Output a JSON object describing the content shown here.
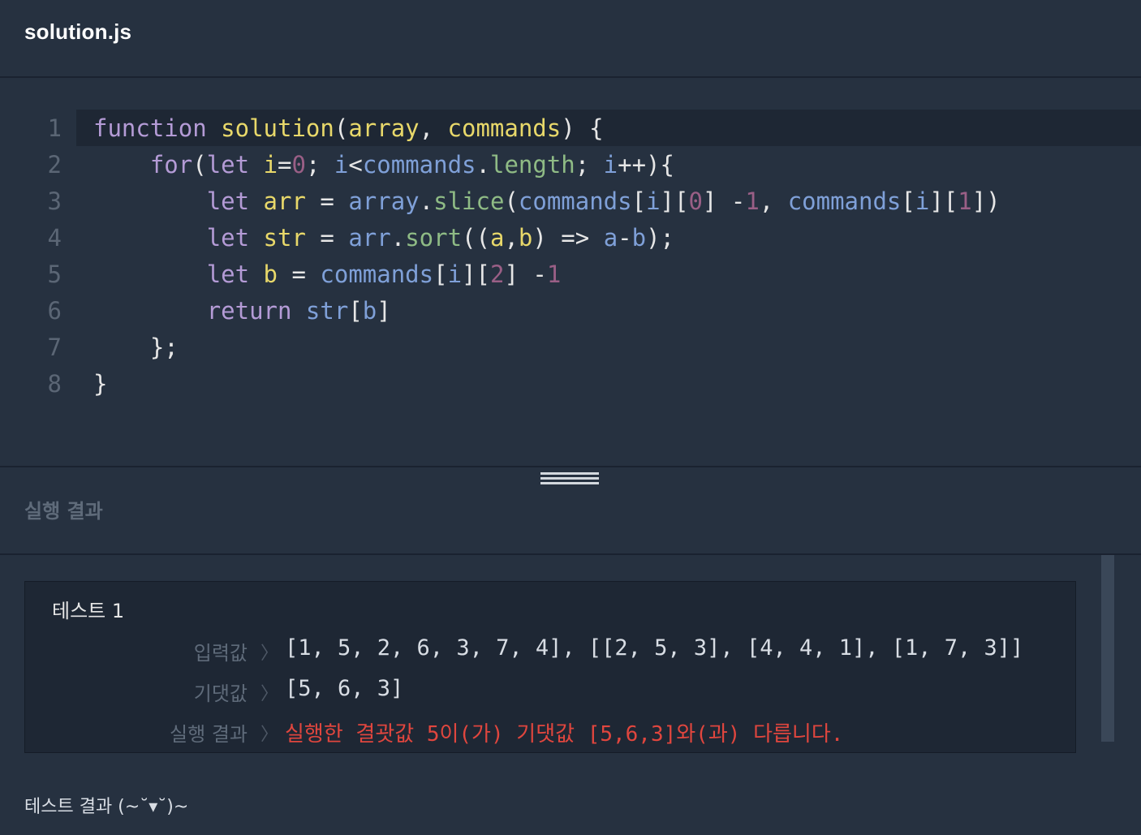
{
  "tab": {
    "filename": "solution.js"
  },
  "editor": {
    "line_numbers": [
      "1",
      "2",
      "3",
      "4",
      "5",
      "6",
      "7",
      "8"
    ]
  },
  "results": {
    "header": "실행 결과",
    "test": {
      "title": "테스트 1",
      "input_label": "입력값",
      "input_value": "[1, 5, 2, 6, 3, 7, 4], [[2, 5, 3], [4, 4, 1], [1, 7, 3]]",
      "expected_label": "기댓값",
      "expected_value": "[5, 6, 3]",
      "result_label": "실행 결과",
      "result_value": "실행한 결괏값 5이(가) 기댓값 [5,6,3]와(과) 다릅니다."
    },
    "summary": "테스트 결과 (~˘▾˘)~"
  },
  "icons": {
    "chevron": "chevron-right-icon",
    "drag": "drag-handle-icon"
  },
  "colors": {
    "background": "#263140",
    "panel": "#1e2734",
    "error": "#e0463e"
  }
}
